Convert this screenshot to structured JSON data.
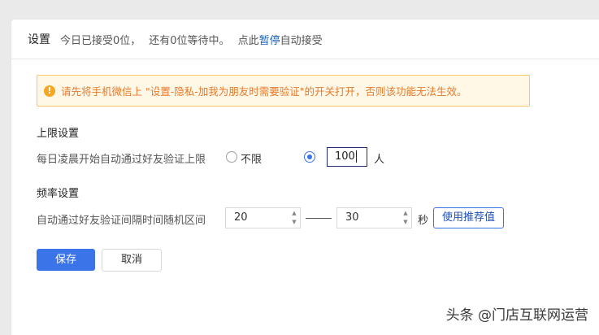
{
  "header": {
    "title": "设置",
    "status_received": "今日已接受0位，",
    "status_waiting": "还有0位等待中。",
    "pause_prefix": "点此",
    "pause_link": "暂停",
    "pause_suffix": "自动接受"
  },
  "alert": {
    "icon": "warning-icon",
    "text": "请先将手机微信上 \"设置-隐私-加我为朋友时需要验证\"的开关打开，否则该功能无法生效。",
    "color": "#e8792a"
  },
  "limit_section": {
    "title": "上限设置",
    "label": "每日凌晨开始自动通过好友验证上限",
    "option_unlimited": "不限",
    "limit_value": "100",
    "unit": "人",
    "selected": "custom"
  },
  "frequency_section": {
    "title": "频率设置",
    "label": "自动通过好友验证间隔时间随机区间",
    "min_value": "20",
    "max_value": "30",
    "unit": "秒",
    "recommend_button": "使用推荐值"
  },
  "actions": {
    "save": "保存",
    "cancel": "取消"
  },
  "watermark": "头条 @门店互联网运营",
  "colors": {
    "primary": "#3b74e8",
    "link": "#1a5fb4",
    "alert_border": "#f6c863",
    "alert_bg": "#fff8e6"
  }
}
